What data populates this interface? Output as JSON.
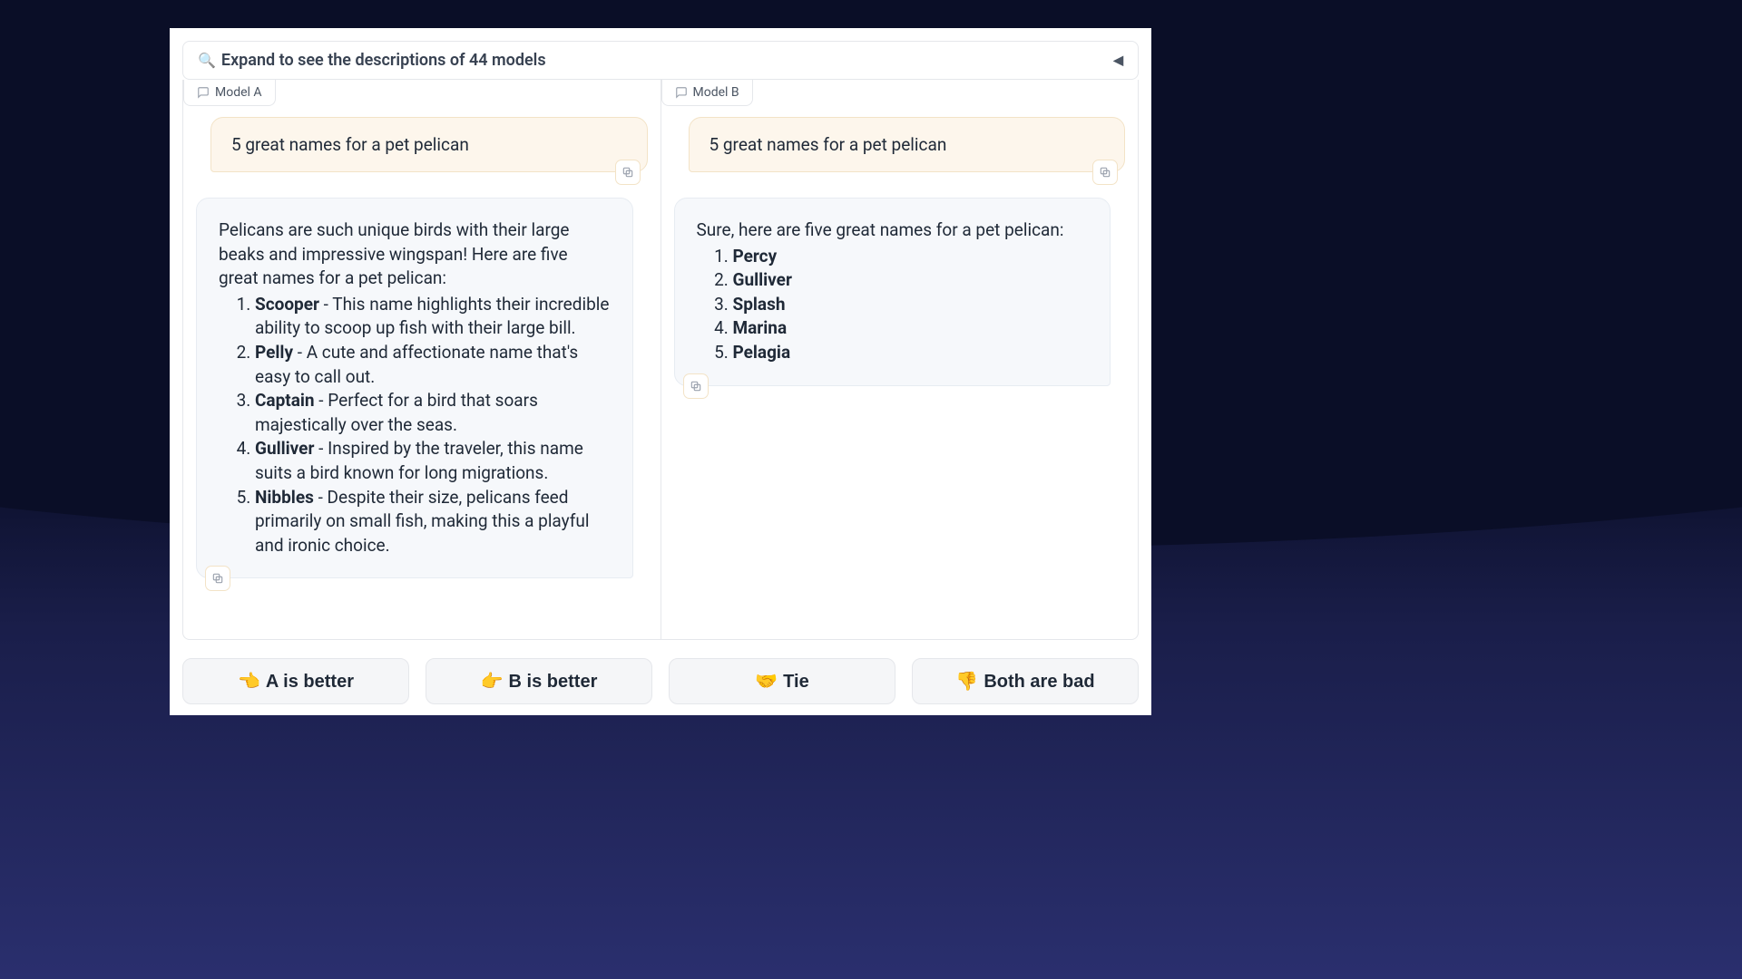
{
  "expand": {
    "label": "Expand to see the descriptions of 44 models"
  },
  "model_a": {
    "label": "Model A"
  },
  "model_b": {
    "label": "Model B"
  },
  "prompt": "5 great names for a pet pelican",
  "resp_a": {
    "intro": "Pelicans are such unique birds with their large beaks and impressive wingspan! Here are five great names for a pet pelican:",
    "items": [
      {
        "name": "Scooper",
        "desc": " - This name highlights their incredible ability to scoop up fish with their large bill."
      },
      {
        "name": "Pelly",
        "desc": " - A cute and affectionate name that's easy to call out."
      },
      {
        "name": "Captain",
        "desc": " - Perfect for a bird that soars majestically over the seas."
      },
      {
        "name": "Gulliver",
        "desc": " - Inspired by the traveler, this name suits a bird known for long migrations."
      },
      {
        "name": "Nibbles",
        "desc": " - Despite their size, pelicans feed primarily on small fish, making this a playful and ironic choice."
      }
    ]
  },
  "resp_b": {
    "intro": "Sure, here are five great names for a pet pelican:",
    "items": [
      {
        "name": "Percy"
      },
      {
        "name": "Gulliver"
      },
      {
        "name": "Splash"
      },
      {
        "name": "Marina"
      },
      {
        "name": "Pelagia"
      }
    ]
  },
  "votes": {
    "a": "A is better",
    "b": "B is better",
    "tie": "Tie",
    "bad": "Both are bad"
  }
}
